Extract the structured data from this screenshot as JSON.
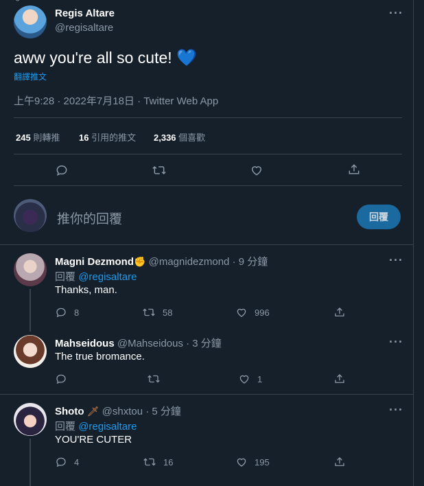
{
  "main_tweet": {
    "display_name": "Regis Altare",
    "handle": "@regisaltare",
    "text": "aww you're all so cute!",
    "emoji": "💙",
    "translate": "翻譯推文",
    "timestamp": "上午9:28 · 2022年7月18日 · Twitter Web App",
    "stats": [
      {
        "num": "245",
        "label": "則轉推"
      },
      {
        "num": "16",
        "label": "引用的推文"
      },
      {
        "num": "2,336",
        "label": "個喜歡"
      }
    ]
  },
  "reply_box": {
    "placeholder": "推你的回覆",
    "button": "回覆"
  },
  "replies": [
    {
      "display_name": "Magni Dezmond",
      "name_emoji": "✊",
      "handle_time": "@magnidezmond · 9 分鐘",
      "reply_to_prefix": "回覆",
      "reply_to": "@regisaltare",
      "text": "Thanks, man.",
      "counts": {
        "reply": "8",
        "retweet": "58",
        "like": "996"
      }
    },
    {
      "display_name": "Mahseidous",
      "handle_time": "@Mahseidous · 3 分鐘",
      "text": "The true bromance.",
      "counts": {
        "reply": "",
        "retweet": "",
        "like": "1"
      }
    },
    {
      "display_name": "Shoto",
      "name_emoji": "🗡",
      "handle_time": "@shxtou · 5 分鐘",
      "reply_to_prefix": "回覆",
      "reply_to": "@regisaltare",
      "text": "YOU'RE CUTER",
      "counts": {
        "reply": "4",
        "retweet": "16",
        "like": "195"
      }
    }
  ],
  "colors": {
    "background": "#15202b",
    "border": "#38444d",
    "accent": "#1d9bf0",
    "muted": "#8b98a5",
    "reply_button": "#1a6aa0"
  }
}
